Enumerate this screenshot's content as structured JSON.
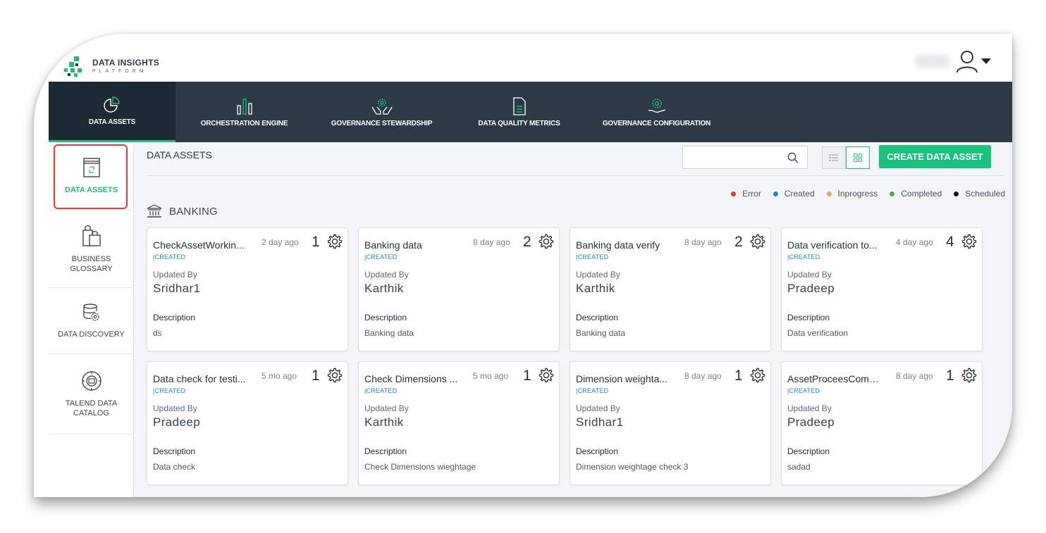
{
  "app": {
    "logo_title": "DATA INSIGHTS",
    "logo_subtitle": "PLATFORM",
    "accent_color": "#19c37d",
    "nav_bg": "#2b3a45"
  },
  "topnav": [
    {
      "label": "DATA ASSETS",
      "icon": "pie-chart-icon",
      "active": true
    },
    {
      "label": "ORCHESTRATION ENGINE",
      "icon": "bar-chart-icon"
    },
    {
      "label": "GOVERNANCE STEWARDSHIP",
      "icon": "hands-gear-icon"
    },
    {
      "label": "DATA QUALITY METRICS",
      "icon": "document-icon"
    },
    {
      "label": "GOVERNANCE CONFIGURATION",
      "icon": "hand-gear-icon"
    }
  ],
  "sidebar": [
    {
      "label": "DATA ASSETS",
      "icon": "data-asset-icon",
      "active": true
    },
    {
      "label": "BUSINESS GLOSSARY",
      "icon": "shopping-bag-icon"
    },
    {
      "label": "DATA DISCOVERY",
      "icon": "database-gear-icon"
    },
    {
      "label": "TALEND DATA CATALOG",
      "icon": "catalog-icon"
    }
  ],
  "main": {
    "page_title": "DATA ASSETS",
    "search_placeholder": "",
    "create_button": "CREATE DATA ASSET",
    "legend": [
      {
        "label": "Error",
        "color": "#e53935"
      },
      {
        "label": "Created",
        "color": "#1e88c7"
      },
      {
        "label": "Inprogress",
        "color": "#f5a15a"
      },
      {
        "label": "Completed",
        "color": "#4caf50"
      },
      {
        "label": "Scheduled",
        "color": "#111111"
      }
    ],
    "group_title": "BANKING",
    "updated_by_label": "Updated By",
    "description_label": "Description",
    "cards": [
      {
        "name": "CheckAssetWorkin...",
        "status": "|CREATED",
        "ago": "2 day ago",
        "count": "1",
        "updated_by": "Sridhar1",
        "description": "ds"
      },
      {
        "name": "Banking data",
        "status": "|CREATED",
        "ago": "8 day ago",
        "count": "2",
        "updated_by": "Karthik",
        "description": "Banking data"
      },
      {
        "name": "Banking data verify",
        "status": "|CREATED",
        "ago": "8 day ago",
        "count": "2",
        "updated_by": "Karthik",
        "description": "Banking data"
      },
      {
        "name": "Data verification to...",
        "status": "|CREATED",
        "ago": "4 day ago",
        "count": "4",
        "updated_by": "Pradeep",
        "description": "Data verification"
      },
      {
        "name": "Data check for testi...",
        "status": "|CREATED",
        "ago": "5 mo ago",
        "count": "1",
        "updated_by": "Pradeep",
        "description": "Data check"
      },
      {
        "name": "Check Dimensions ...",
        "status": "|CREATED",
        "ago": "5 mo ago",
        "count": "1",
        "updated_by": "Karthik",
        "description": "Check Dimensions wieghtage"
      },
      {
        "name": "Dimension weighta...",
        "status": "|CREATED",
        "ago": "8 day ago",
        "count": "1",
        "updated_by": "Sridhar1",
        "description": "Dimension weightage check 3"
      },
      {
        "name": "AssetProceesComp...",
        "status": "|CREATED",
        "ago": "8 day ago",
        "count": "1",
        "updated_by": "Pradeep",
        "description": "sadad"
      }
    ]
  }
}
